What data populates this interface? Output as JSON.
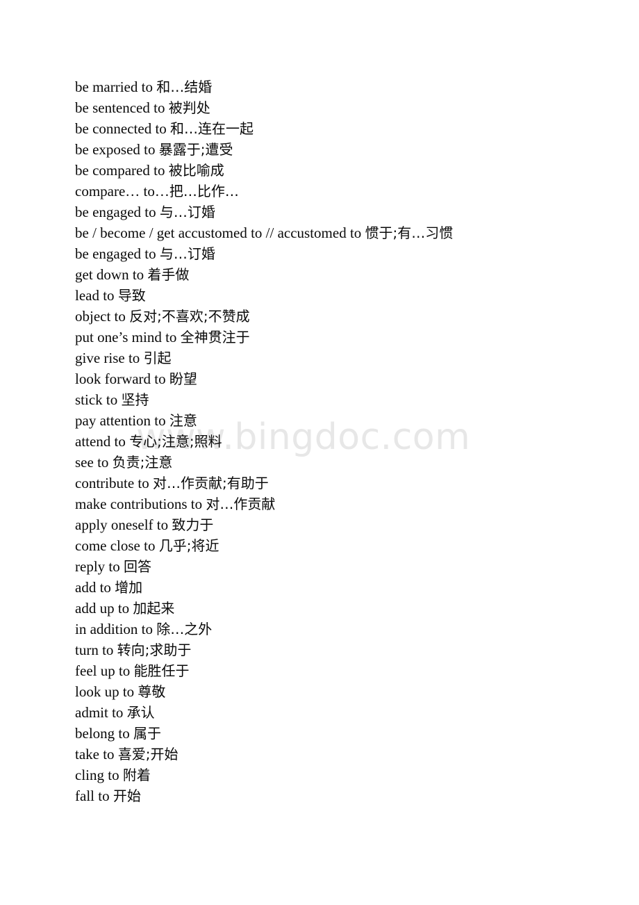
{
  "document": {
    "title": "English Phrasal Verbs with \"to\" — Chinese Glossary",
    "background_color": "#ffffff",
    "text_color": "#0a0a0a"
  },
  "watermark": {
    "text": "www.bingdoc.com",
    "color": "#e7e7e7"
  },
  "lines": [
    {
      "en": "be married to ",
      "zh": "和…结婚"
    },
    {
      "en": "be sentenced to ",
      "zh": "被判处"
    },
    {
      "en": "be connected to ",
      "zh": "和…连在一起"
    },
    {
      "en": "be exposed to ",
      "zh": "暴露于;遭受"
    },
    {
      "en": "be compared to ",
      "zh": "被比喻成"
    },
    {
      "en": "compare… to…",
      "zh": "把…比作…"
    },
    {
      "en": "be engaged to ",
      "zh": "与…订婚"
    },
    {
      "en": "be / become / get accustomed to // accustomed to ",
      "zh": "惯于;有…习惯"
    },
    {
      "en": "be engaged to ",
      "zh": "与…订婚"
    },
    {
      "en": "get down to ",
      "zh": "着手做"
    },
    {
      "en": "lead to ",
      "zh": "导致"
    },
    {
      "en": "object to ",
      "zh": "反对;不喜欢;不赞成"
    },
    {
      "en": "put one’s mind to ",
      "zh": "全神贯注于"
    },
    {
      "en": "give rise to ",
      "zh": "引起"
    },
    {
      "en": "look forward to ",
      "zh": "盼望"
    },
    {
      "en": "stick to ",
      "zh": "坚持"
    },
    {
      "en": "pay attention to ",
      "zh": "注意"
    },
    {
      "en": "attend to ",
      "zh": "专心;注意;照料"
    },
    {
      "en": "see to ",
      "zh": "负责;注意"
    },
    {
      "en": "contribute to ",
      "zh": "对…作贡献;有助于"
    },
    {
      "en": "make contributions to ",
      "zh": "对…作贡献"
    },
    {
      "en": "apply oneself to ",
      "zh": "致力于"
    },
    {
      "en": "come close to ",
      "zh": "几乎;将近"
    },
    {
      "en": "reply to ",
      "zh": "回答"
    },
    {
      "en": "add to ",
      "zh": "增加"
    },
    {
      "en": "add up to ",
      "zh": "加起来"
    },
    {
      "en": "in addition to ",
      "zh": "除…之外"
    },
    {
      "en": "turn to ",
      "zh": "转向;求助于"
    },
    {
      "en": "feel up to ",
      "zh": "能胜任于"
    },
    {
      "en": "look up to ",
      "zh": "尊敬"
    },
    {
      "en": "admit to ",
      "zh": "承认"
    },
    {
      "en": "belong to ",
      "zh": "属于"
    },
    {
      "en": "take to ",
      "zh": "喜爱;开始"
    },
    {
      "en": "cling to ",
      "zh": "附着"
    },
    {
      "en": "fall to ",
      "zh": "开始"
    }
  ]
}
